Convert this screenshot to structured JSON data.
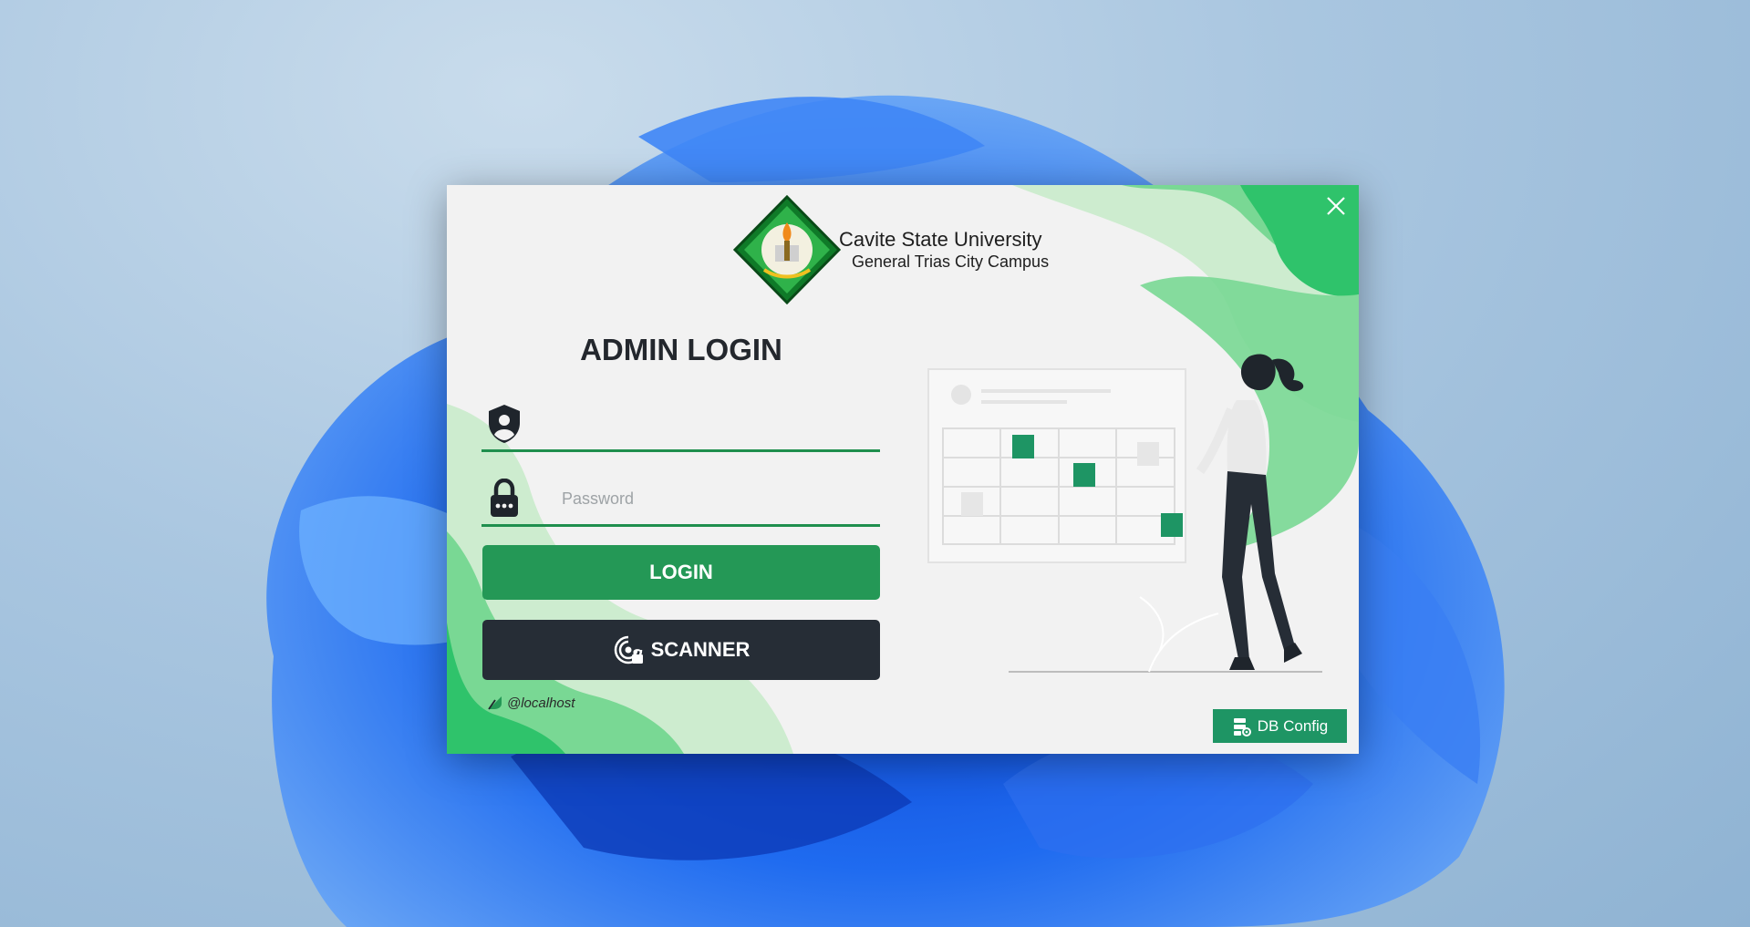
{
  "university": {
    "name": "Cavite State University",
    "campus": "General Trias City Campus"
  },
  "login": {
    "title": "ADMIN LOGIN",
    "username_value": "",
    "username_placeholder": "",
    "password_value": "",
    "password_placeholder": "Password",
    "login_label": "LOGIN",
    "scanner_label": "SCANNER"
  },
  "status": {
    "server": "@localhost"
  },
  "footer": {
    "db_config_label": "DB Config"
  },
  "icons": {
    "close": "close-icon",
    "user": "user-shield-icon",
    "password": "lock-icon",
    "scanner": "scanner-icon",
    "server": "server-status-icon",
    "db_config": "database-settings-icon"
  },
  "colors": {
    "accent_green": "#249856",
    "dark_button": "#262d36",
    "db_config_bg": "#1e9564",
    "window_bg": "#f2f2f2"
  }
}
